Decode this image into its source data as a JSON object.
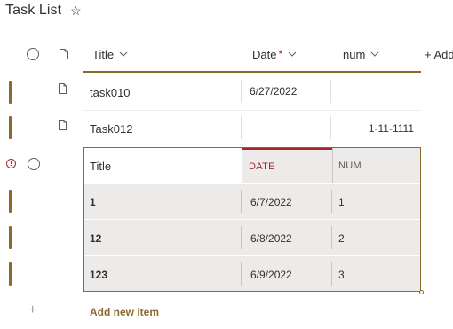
{
  "list": {
    "title": "Task List",
    "star_icon": "star-outline-icon"
  },
  "columns": {
    "title_label": "Title",
    "date_label": "Date",
    "date_required_marker": "*",
    "num_label": "num",
    "add_column_label": "+ Add"
  },
  "rows": [
    {
      "title": "task010",
      "date": "6/27/2022",
      "num": ""
    },
    {
      "title": "Task012",
      "date": "",
      "num": "1-11-1111"
    }
  ],
  "quick_edit": {
    "title_label": "Title",
    "date_label": "DATE",
    "num_label": "NUM",
    "rows": [
      {
        "title": "1",
        "date": "6/7/2022",
        "num": "1"
      },
      {
        "title": "12",
        "date": "6/8/2022",
        "num": "2"
      },
      {
        "title": "123",
        "date": "6/9/2022",
        "num": "3"
      }
    ]
  },
  "footer": {
    "add_new_item_label": "Add new item"
  },
  "colors": {
    "accent": "#8a6a2f",
    "error": "#a4262c",
    "text": "#323130",
    "quick_edit_bg": "#edebe9"
  }
}
